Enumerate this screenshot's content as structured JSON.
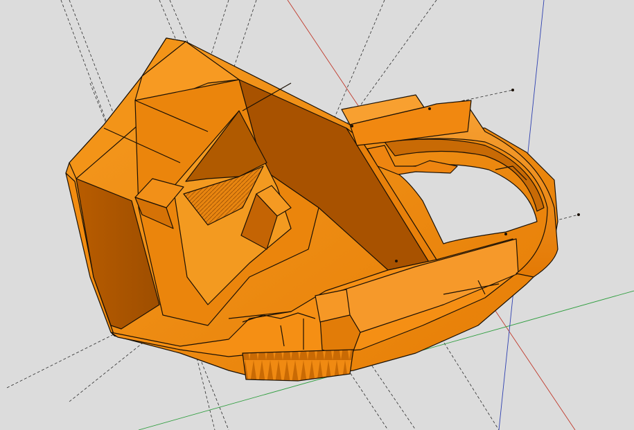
{
  "viewport": {
    "background_color": "#dcdcdc",
    "model_color": "#f28c10",
    "model_shadow_color": "#a85200",
    "model_mid_color": "#e07808",
    "edge_color": "#1a1005",
    "axis_red_color": "#c0392b",
    "axis_green_color": "#2e9e3e",
    "axis_blue_color": "#2d3fb0",
    "guide_line_color": "#2a2a2a"
  }
}
